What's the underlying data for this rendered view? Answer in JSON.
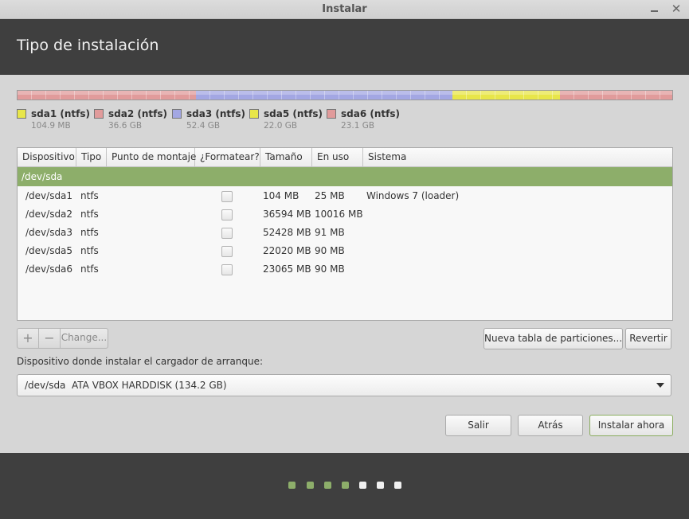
{
  "window": {
    "title": "Instalar"
  },
  "header": {
    "title": "Tipo de instalación"
  },
  "colors": {
    "red": "#e19b9b",
    "blue": "#a3a7e3",
    "yellow": "#e8e64a",
    "accent_green": "#8dae6a",
    "header_bg": "#3f3f3f"
  },
  "partitions": [
    {
      "label": "sda1 (ntfs)",
      "size": "104.9 MB",
      "color": "red"
    },
    {
      "label": "sda2 (ntfs)",
      "size": "36.6 GB",
      "color": "red"
    },
    {
      "label": "sda3 (ntfs)",
      "size": "52.4 GB",
      "color": "blue"
    },
    {
      "label": "sda5 (ntfs)",
      "size": "22.0 GB",
      "color": "yellow"
    },
    {
      "label": "sda6 (ntfs)",
      "size": "23.1 GB",
      "color": "red"
    }
  ],
  "table": {
    "columns": [
      "Dispositivo",
      "Tipo",
      "Punto de montaje",
      "¿Formatear?",
      "Tamaño",
      "En uso",
      "Sistema"
    ],
    "group": "/dev/sda",
    "rows": [
      {
        "device": "/dev/sda1",
        "type": "ntfs",
        "mount": "",
        "format": false,
        "size": "104 MB",
        "used": "25 MB",
        "system": "Windows 7 (loader)"
      },
      {
        "device": "/dev/sda2",
        "type": "ntfs",
        "mount": "",
        "format": false,
        "size": "36594 MB",
        "used": "10016 MB",
        "system": ""
      },
      {
        "device": "/dev/sda3",
        "type": "ntfs",
        "mount": "",
        "format": false,
        "size": "52428 MB",
        "used": "91 MB",
        "system": ""
      },
      {
        "device": "/dev/sda5",
        "type": "ntfs",
        "mount": "",
        "format": false,
        "size": "22020 MB",
        "used": "90 MB",
        "system": ""
      },
      {
        "device": "/dev/sda6",
        "type": "ntfs",
        "mount": "",
        "format": false,
        "size": "23065 MB",
        "used": "90 MB",
        "system": ""
      }
    ]
  },
  "toolbar": {
    "add": "+",
    "remove": "−",
    "change": "Change...",
    "new_table": "Nueva tabla de particiones...",
    "revert": "Revertir"
  },
  "bootloader": {
    "label": "Dispositivo donde instalar el cargador de arranque:",
    "device": "/dev/sda",
    "description": "ATA VBOX HARDDISK (134.2 GB)"
  },
  "actions": {
    "quit": "Salir",
    "back": "Atrás",
    "install": "Instalar ahora"
  },
  "progress": {
    "total_steps": 7,
    "completed_steps": 4
  }
}
